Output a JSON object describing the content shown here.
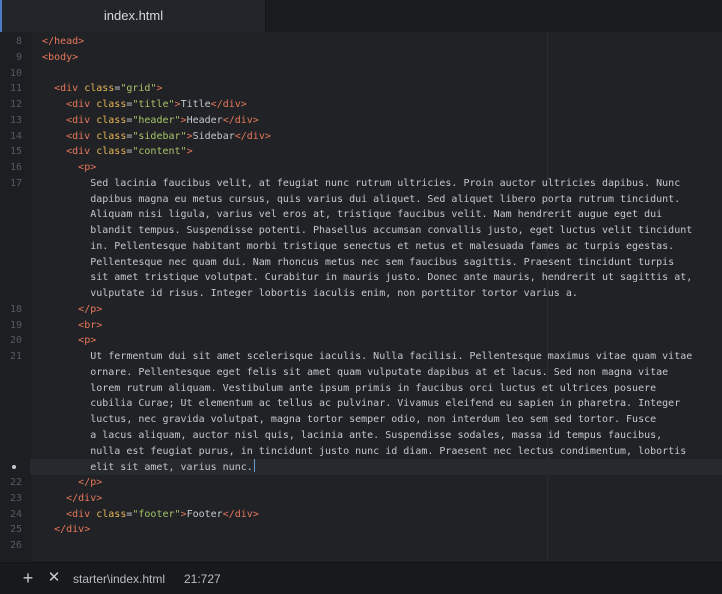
{
  "tab": {
    "label": "index.html"
  },
  "editor": {
    "active_line": 21,
    "lines": [
      {
        "num": "8",
        "tokens": [
          {
            "t": "  ",
            "c": "txt"
          },
          {
            "t": "</head>",
            "c": "tag"
          }
        ]
      },
      {
        "num": "9",
        "tokens": [
          {
            "t": "  ",
            "c": "txt"
          },
          {
            "t": "<body>",
            "c": "tag"
          }
        ]
      },
      {
        "num": "10",
        "tokens": []
      },
      {
        "num": "11",
        "tokens": [
          {
            "t": "    ",
            "c": "txt"
          },
          {
            "t": "<div ",
            "c": "tag"
          },
          {
            "t": "class",
            "c": "attr"
          },
          {
            "t": "=",
            "c": "txt"
          },
          {
            "t": "\"grid\"",
            "c": "str"
          },
          {
            "t": ">",
            "c": "tag"
          }
        ]
      },
      {
        "num": "12",
        "tokens": [
          {
            "t": "      ",
            "c": "txt"
          },
          {
            "t": "<div ",
            "c": "tag"
          },
          {
            "t": "class",
            "c": "attr"
          },
          {
            "t": "=",
            "c": "txt"
          },
          {
            "t": "\"title\"",
            "c": "str"
          },
          {
            "t": ">",
            "c": "tag"
          },
          {
            "t": "Title",
            "c": "txt"
          },
          {
            "t": "</div>",
            "c": "tag"
          }
        ]
      },
      {
        "num": "13",
        "tokens": [
          {
            "t": "      ",
            "c": "txt"
          },
          {
            "t": "<div ",
            "c": "tag"
          },
          {
            "t": "class",
            "c": "attr"
          },
          {
            "t": "=",
            "c": "txt"
          },
          {
            "t": "\"header\"",
            "c": "str"
          },
          {
            "t": ">",
            "c": "tag"
          },
          {
            "t": "Header",
            "c": "txt"
          },
          {
            "t": "</div>",
            "c": "tag"
          }
        ]
      },
      {
        "num": "14",
        "tokens": [
          {
            "t": "      ",
            "c": "txt"
          },
          {
            "t": "<div ",
            "c": "tag"
          },
          {
            "t": "class",
            "c": "attr"
          },
          {
            "t": "=",
            "c": "txt"
          },
          {
            "t": "\"sidebar\"",
            "c": "str"
          },
          {
            "t": ">",
            "c": "tag"
          },
          {
            "t": "Sidebar",
            "c": "txt"
          },
          {
            "t": "</div>",
            "c": "tag"
          }
        ]
      },
      {
        "num": "15",
        "tokens": [
          {
            "t": "      ",
            "c": "txt"
          },
          {
            "t": "<div ",
            "c": "tag"
          },
          {
            "t": "class",
            "c": "attr"
          },
          {
            "t": "=",
            "c": "txt"
          },
          {
            "t": "\"content\"",
            "c": "str"
          },
          {
            "t": ">",
            "c": "tag"
          }
        ]
      },
      {
        "num": "16",
        "tokens": [
          {
            "t": "        ",
            "c": "txt"
          },
          {
            "t": "<p>",
            "c": "tag"
          }
        ]
      },
      {
        "num": "17",
        "wrapped": [
          "          Sed lacinia faucibus velit, at feugiat nunc rutrum ultricies. Proin auctor ultricies dapibus. Nunc",
          "          dapibus magna eu metus cursus, quis varius dui aliquet. Sed aliquet libero porta rutrum tincidunt.",
          "          Aliquam nisi ligula, varius vel eros at, tristique faucibus velit. Nam hendrerit augue eget dui",
          "          blandit tempus. Suspendisse potenti. Phasellus accumsan convallis justo, eget luctus velit tincidunt",
          "          in. Pellentesque habitant morbi tristique senectus et netus et malesuada fames ac turpis egestas.",
          "          Pellentesque nec quam dui. Nam rhoncus metus nec sem faucibus sagittis. Praesent tincidunt turpis",
          "          sit amet tristique volutpat. Curabitur in mauris justo. Donec ante mauris, hendrerit ut sagittis at,",
          "          vulputate id risus. Integer lobortis iaculis enim, non porttitor tortor varius a."
        ]
      },
      {
        "num": "18",
        "tokens": [
          {
            "t": "        ",
            "c": "txt"
          },
          {
            "t": "</p>",
            "c": "tag"
          }
        ]
      },
      {
        "num": "19",
        "tokens": [
          {
            "t": "        ",
            "c": "txt"
          },
          {
            "t": "<br>",
            "c": "tag"
          }
        ]
      },
      {
        "num": "20",
        "tokens": [
          {
            "t": "        ",
            "c": "txt"
          },
          {
            "t": "<p>",
            "c": "tag"
          }
        ]
      },
      {
        "num": "21",
        "wrapped": [
          "          Ut fermentum dui sit amet scelerisque iaculis. Nulla facilisi. Pellentesque maximus vitae quam vitae",
          "          ornare. Pellentesque eget felis sit amet quam vulputate dapibus at et lacus. Sed non magna vitae",
          "          lorem rutrum aliquam. Vestibulum ante ipsum primis in faucibus orci luctus et ultrices posuere",
          "          cubilia Curae; Ut elementum ac tellus ac pulvinar. Vivamus eleifend eu sapien in pharetra. Integer",
          "          luctus, nec gravida volutpat, magna tortor semper odio, non interdum leo sem sed tortor. Fusce",
          "          a lacus aliquam, auctor nisl quis, lacinia ante. Suspendisse sodales, massa id tempus faucibus,",
          "          nulla est feugiat purus, in tincidunt justo nunc id diam. Praesent nec lectus condimentum, lobortis",
          "          elit sit amet, varius nunc."
        ]
      },
      {
        "num": "22",
        "tokens": [
          {
            "t": "        ",
            "c": "txt"
          },
          {
            "t": "</p>",
            "c": "tag"
          }
        ]
      },
      {
        "num": "23",
        "tokens": [
          {
            "t": "      ",
            "c": "txt"
          },
          {
            "t": "</div>",
            "c": "tag"
          }
        ]
      },
      {
        "num": "24",
        "tokens": [
          {
            "t": "      ",
            "c": "txt"
          },
          {
            "t": "<div ",
            "c": "tag"
          },
          {
            "t": "class",
            "c": "attr"
          },
          {
            "t": "=",
            "c": "txt"
          },
          {
            "t": "\"footer\"",
            "c": "str"
          },
          {
            "t": ">",
            "c": "tag"
          },
          {
            "t": "Footer",
            "c": "txt"
          },
          {
            "t": "</div>",
            "c": "tag"
          }
        ]
      },
      {
        "num": "25",
        "tokens": [
          {
            "t": "    ",
            "c": "txt"
          },
          {
            "t": "</div>",
            "c": "tag"
          }
        ]
      },
      {
        "num": "26",
        "tokens": []
      }
    ]
  },
  "statusbar": {
    "add_icon": "plus-icon",
    "close_icon": "close-icon",
    "file_path": "starter\\index.html",
    "cursor_position": "21:727"
  },
  "colors": {
    "tag": "#e8785a",
    "attr": "#e6b556",
    "string": "#a7c46a",
    "text": "#c3c8cf",
    "background": "#202226",
    "accent": "#4d79c7"
  }
}
